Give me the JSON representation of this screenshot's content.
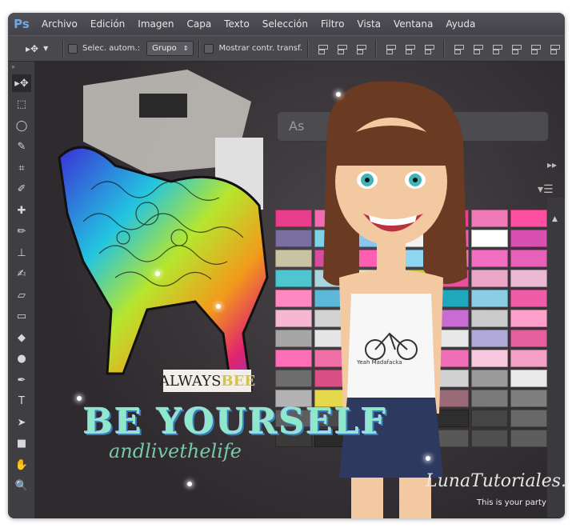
{
  "app": {
    "logo": "Ps"
  },
  "menu": [
    "Archivo",
    "Edición",
    "Imagen",
    "Capa",
    "Texto",
    "Selección",
    "Filtro",
    "Vista",
    "Ventana",
    "Ayuda"
  ],
  "options": {
    "auto_select_label": "Selec. autom.:",
    "auto_select_mode": "Grupo",
    "show_transform_label": "Mostrar contr. transf."
  },
  "tools": [
    {
      "name": "move-tool",
      "icon": "move-icon",
      "glyph": "▸✥"
    },
    {
      "name": "marquee-tool",
      "icon": "marquee-icon",
      "glyph": "⬚"
    },
    {
      "name": "lasso-tool",
      "icon": "lasso-icon",
      "glyph": "◯"
    },
    {
      "name": "quick-select-tool",
      "icon": "wand-icon",
      "glyph": "✎"
    },
    {
      "name": "crop-tool",
      "icon": "crop-icon",
      "glyph": "⌗"
    },
    {
      "name": "eyedropper-tool",
      "icon": "eyedropper-icon",
      "glyph": "✐"
    },
    {
      "name": "healing-tool",
      "icon": "bandage-icon",
      "glyph": "✚"
    },
    {
      "name": "brush-tool",
      "icon": "brush-icon",
      "glyph": "✏"
    },
    {
      "name": "stamp-tool",
      "icon": "stamp-icon",
      "glyph": "⊥"
    },
    {
      "name": "history-brush-tool",
      "icon": "history-brush-icon",
      "glyph": "✍"
    },
    {
      "name": "eraser-tool",
      "icon": "eraser-icon",
      "glyph": "▱"
    },
    {
      "name": "gradient-tool",
      "icon": "gradient-icon",
      "glyph": "▭"
    },
    {
      "name": "blur-tool",
      "icon": "drop-icon",
      "glyph": "◆"
    },
    {
      "name": "dodge-tool",
      "icon": "dodge-icon",
      "glyph": "●"
    },
    {
      "name": "pen-tool",
      "icon": "pen-icon",
      "glyph": "✒"
    },
    {
      "name": "type-tool",
      "icon": "type-icon",
      "glyph": "T"
    },
    {
      "name": "path-select-tool",
      "icon": "arrow-icon",
      "glyph": "➤"
    },
    {
      "name": "shape-tool",
      "icon": "rectangle-icon",
      "glyph": "■"
    },
    {
      "name": "hand-tool",
      "icon": "hand-icon",
      "glyph": "✋"
    },
    {
      "name": "zoom-tool",
      "icon": "zoom-icon",
      "glyph": "🔍"
    }
  ],
  "canvas": {
    "ghost_field": "As",
    "always_text": "ALWAYS",
    "always_text_tail": "BEE",
    "headline": "BE YOURSELF",
    "subline": "andlivethelife",
    "signature": "LunaTutoriales.",
    "tagline": "This is your party",
    "shirt_text": "Yeah Madafacka"
  },
  "colors": {
    "swatches": [
      "#e83d8a",
      "#f06bb0",
      "#e24fa8",
      "#f25fb7",
      "#ea3e93",
      "#f07ab8",
      "#ff4fa0",
      "#7a6fa0",
      "#7fd2e6",
      "#89c7f2",
      "#f2f2f2",
      "#ec5fb7",
      "#ffffff",
      "#d94fb2",
      "#c9c3a3",
      "#d94b9c",
      "#ff5fb3",
      "#8ed7f0",
      "#f76fc4",
      "#f26ec2",
      "#e861b8",
      "#4ec6cf",
      "#a8d5de",
      "#dfe6c0",
      "#c6cd2f",
      "#e94f9a",
      "#eaa7c8",
      "#ebb9d3",
      "#ff88c0",
      "#5bb8d6",
      "#d3de7a",
      "#e9519f",
      "#1ea7bd",
      "#8acde4",
      "#f05ca8",
      "#f5b7d2",
      "#d3d3d3",
      "#f5e56b",
      "#d0d0d0",
      "#c86bd3",
      "#cacaca",
      "#ff9fcc",
      "#a6a6a6",
      "#e5e5e5",
      "#ee6cb5",
      "#c6c6c6",
      "#e8e8e8",
      "#b1a9d8",
      "#e45f9c",
      "#ff6fb7",
      "#f16fa7",
      "#e36690",
      "#da5181",
      "#f06fb7",
      "#f8c8de",
      "#f4a0c6",
      "#6d6d6d",
      "#d94f86",
      "#e44f82",
      "#f0d145",
      "#d2d2d2",
      "#9a9a9a",
      "#e9e9e9",
      "#b3b3b3",
      "#e6d84b",
      "#aaaaaa",
      "#b06f8e",
      "#9a6a77",
      "#7a7a7a",
      "#7f7f7f",
      "#5e5e5e",
      "#4a4a4a",
      "#3c3c3c",
      "#c94f7f",
      "#2e2e2e",
      "#454545",
      "#686868",
      "#3a3a3a",
      "#2a2a2a",
      "#c0487a",
      "#7a7a7a",
      "#585858",
      "#4f4f4f",
      "#5d5d5d"
    ]
  }
}
